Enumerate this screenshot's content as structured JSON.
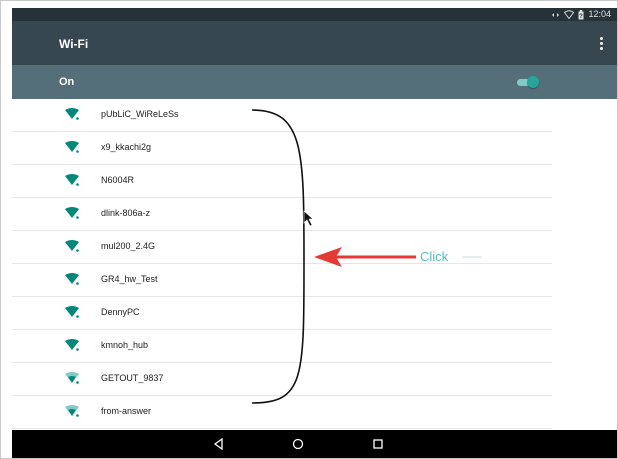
{
  "status_bar": {
    "time": "12:04",
    "icons": [
      "data-arrows-icon",
      "wifi-status-icon",
      "battery-icon"
    ]
  },
  "app_bar": {
    "title": "Wi-Fi",
    "overflow_icon": "more-vert-icon"
  },
  "wifi_switch": {
    "label": "On",
    "enabled": true,
    "accent": "#26a69a"
  },
  "networks": [
    {
      "ssid": "pUbLiC_WiReLeSs",
      "secured": false,
      "strength": 4
    },
    {
      "ssid": "x9_kkachi2g",
      "secured": false,
      "strength": 4
    },
    {
      "ssid": "N6004R",
      "secured": false,
      "strength": 4
    },
    {
      "ssid": "dlink-806a-z",
      "secured": false,
      "strength": 4
    },
    {
      "ssid": "mul200_2.4G",
      "secured": false,
      "strength": 4
    },
    {
      "ssid": "GR4_hw_Test",
      "secured": false,
      "strength": 4
    },
    {
      "ssid": "DennyPC",
      "secured": false,
      "strength": 4
    },
    {
      "ssid": "kmnoh_hub",
      "secured": false,
      "strength": 4
    },
    {
      "ssid": "GETOUT_9837",
      "secured": false,
      "strength": 3
    },
    {
      "ssid": "from-answer",
      "secured": false,
      "strength": 3
    }
  ],
  "nav_bar": {
    "buttons": [
      "back-icon",
      "home-icon",
      "recents-icon"
    ]
  },
  "annotation": {
    "label": "Click",
    "color": "#e53935",
    "label_color": "#4fc3c7"
  }
}
